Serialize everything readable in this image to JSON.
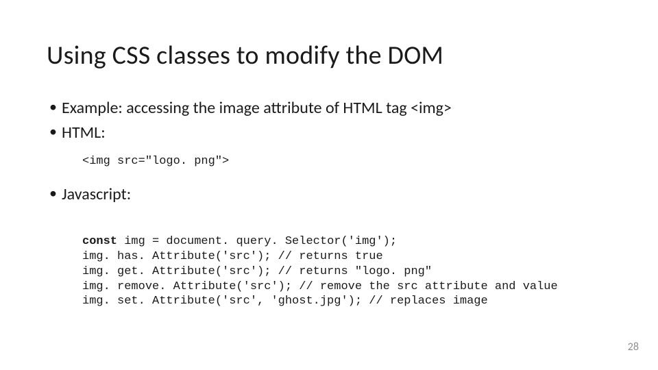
{
  "title": "Using CSS classes to modify the DOM",
  "bullet1": "Example: accessing the image attribute of HTML tag <img>",
  "bullet2": "HTML:",
  "code1": "<img src=\"logo. png\">",
  "bullet3": "Javascript:",
  "js_kw": "const",
  "js_line1": " img = document. query. Selector('img');",
  "js_line2": "img. has. Attribute('src'); // returns true",
  "js_line3": "img. get. Attribute('src'); // returns \"logo. png\"",
  "js_line4": "img. remove. Attribute('src'); // remove the src attribute and value",
  "js_line5": "img. set. Attribute('src', 'ghost.jpg'); // replaces image",
  "page_number": "28"
}
